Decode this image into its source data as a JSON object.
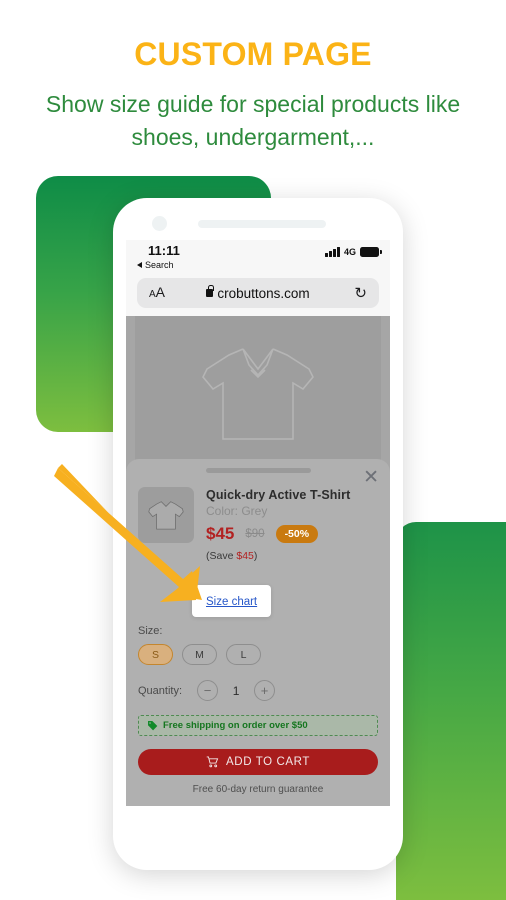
{
  "headline": "CUSTOM PAGE",
  "subhead": "Show size guide for special products like shoes, undergarment,...",
  "colors": {
    "headline": "#FBB316",
    "subhead": "#2E8B3D",
    "green_dark": "#0E8C47",
    "green_light": "#7DBE3F",
    "arrow": "#F7B020",
    "price": "#b22222",
    "badge": "#c97a10",
    "link": "#2757c9",
    "cart": "#a81c1c"
  },
  "phone": {
    "status_bar": {
      "time": "11:11",
      "back_label": "Search",
      "back_icon": "triangle-left-icon",
      "signal_icon": "signal-bars-icon",
      "network": "4G",
      "battery_icon": "battery-full-icon"
    },
    "browser": {
      "text_size_small": "A",
      "text_size_big": "A",
      "text_size_icon": "text-size-icon",
      "lock_icon": "lock-icon",
      "url": "crobuttons.com",
      "reload_icon": "reload-icon",
      "reload_glyph": "↻"
    },
    "hero": {
      "image_alt": "polo-shirt-outline"
    },
    "sheet": {
      "handle_icon": "drag-handle-icon",
      "close_icon": "close-icon",
      "close_glyph": "✕",
      "product": {
        "thumb_alt": "tshirt-thumbnail",
        "title": "Quick-dry Active T-Shirt",
        "color_line": "Color: Grey",
        "price_current": "$45",
        "price_original": "$90",
        "discount_badge": "-50%",
        "save_prefix": "(Save ",
        "save_amount": "$45",
        "save_suffix": ")"
      },
      "size_chart": {
        "link_label": "Size chart"
      },
      "size": {
        "label": "Size:",
        "options": [
          "S",
          "M",
          "L"
        ],
        "selected": "S"
      },
      "quantity": {
        "label": "Quantity:",
        "decrement_icon": "minus-icon",
        "decrement_glyph": "−",
        "value": "1",
        "increment_icon": "plus-icon",
        "increment_glyph": "+"
      },
      "shipping_banner": {
        "tag_icon": "tag-icon",
        "tag_glyph": "🏷",
        "text": "Free shipping on order over $50"
      },
      "cart_button": {
        "cart_icon": "shopping-cart-icon",
        "label": "ADD TO CART"
      },
      "guarantee": "Free 60-day return guarantee"
    }
  },
  "annotation": {
    "arrow_icon": "pointer-arrow-icon",
    "points_to": "Size chart"
  }
}
